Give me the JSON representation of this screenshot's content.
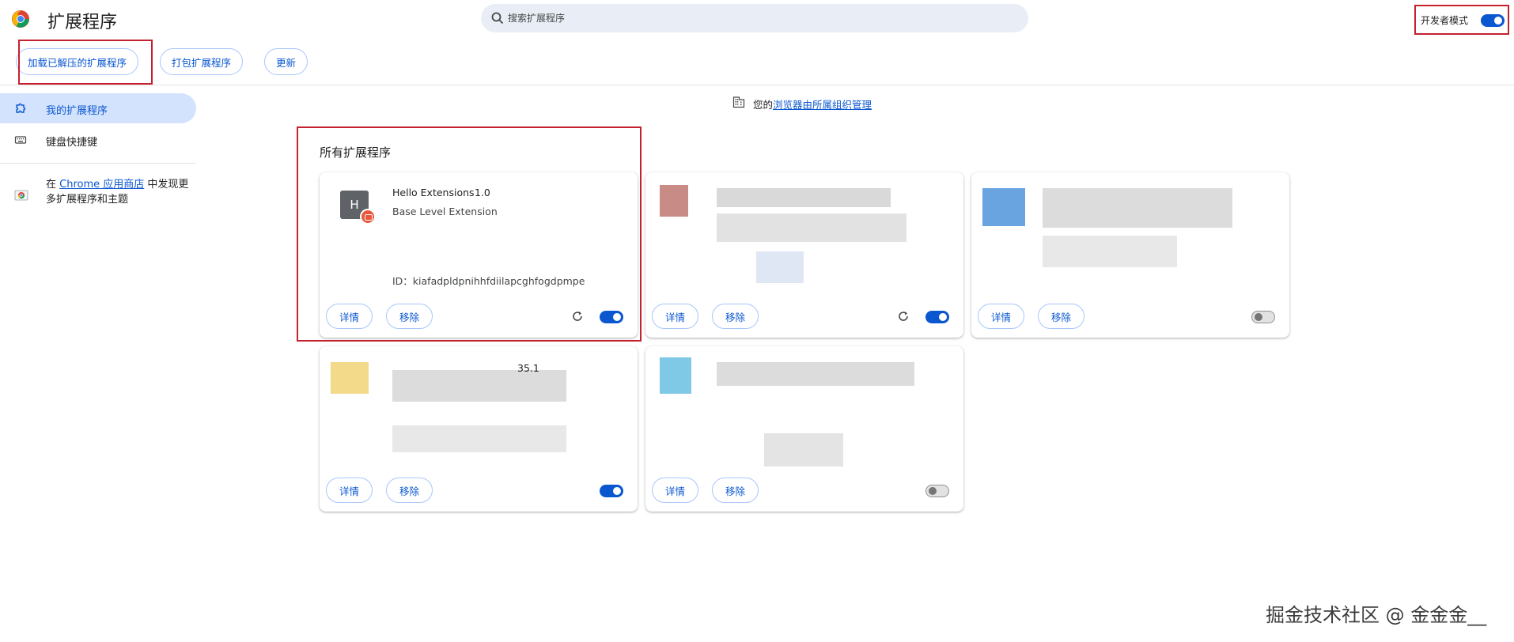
{
  "header": {
    "title": "扩展程序",
    "search_placeholder": "搜索扩展程序",
    "dev_mode_label": "开发者模式",
    "dev_mode_on": true
  },
  "toolbar": {
    "load_unpacked": "加载已解压的扩展程序",
    "pack": "打包扩展程序",
    "update": "更新"
  },
  "sidebar": {
    "items": [
      {
        "label": "我的扩展程序",
        "icon": "puzzle-icon",
        "active": true
      },
      {
        "label": "键盘快捷键",
        "icon": "keyboard-icon",
        "active": false
      }
    ],
    "store_prefix": "在 ",
    "store_link": "Chrome 应用商店",
    "store_suffix": " 中发现更多扩展程序和主题"
  },
  "managed": {
    "prefix": "您的",
    "link": "浏览器由所属组织管理"
  },
  "section_title": "所有扩展程序",
  "cards": [
    {
      "avatar_letter": "H",
      "name": "Hello Extensions",
      "version": "1.0",
      "description": "Base Level Extension",
      "id": "ID：kiafadpldpnihhfdiilapcghfogdpmpe",
      "details_label": "详情",
      "remove_label": "移除",
      "enabled": true
    },
    {
      "version": "",
      "details_label": "详情",
      "remove_label": "移除",
      "enabled": true
    },
    {
      "details_label": "详情",
      "remove_label": "移除",
      "enabled": false
    },
    {
      "version": "35.1",
      "details_label": "详情",
      "remove_label": "移除",
      "enabled": true
    },
    {
      "details_label": "详情",
      "remove_label": "移除",
      "enabled": false
    }
  ],
  "watermark": "掘金技术社区 @ 金金金__",
  "colors": {
    "accent": "#0b57d0",
    "active_bg": "#d3e3fd",
    "annotation_red": "#c4202e"
  }
}
